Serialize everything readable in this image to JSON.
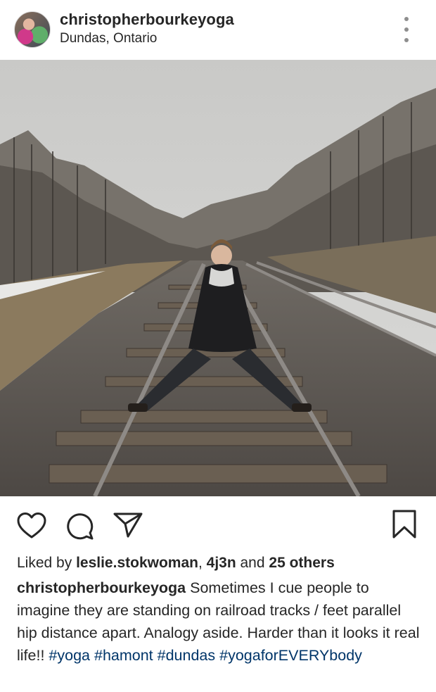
{
  "post": {
    "username": "christopherbourkeyoga",
    "location": "Dundas, Ontario",
    "photo_alt": "Person standing with feet wide apart on railroad tracks in a wintry forest"
  },
  "icons": {
    "more": "more-options-icon",
    "like": "heart-icon",
    "comment": "comment-icon",
    "share": "paper-plane-icon",
    "save": "bookmark-icon"
  },
  "likes": {
    "prefix": "Liked by ",
    "user1": "leslie.stokwoman",
    "separator": ", ",
    "user2": "4j3n",
    "and": " and ",
    "others": "25 others"
  },
  "caption": {
    "author": "christopherbourkeyoga",
    "text": " Sometimes I cue people to imagine they are standing on railroad tracks / feet parallel hip distance apart. Analogy aside. Harder than it looks it real life!! ",
    "hashtags": [
      "#yoga",
      "#hamont",
      "#dundas",
      "#yogaforEVERYbody"
    ]
  },
  "colors": {
    "text": "#262626",
    "hashtag": "#003569",
    "muted": "#8e8e8e"
  }
}
